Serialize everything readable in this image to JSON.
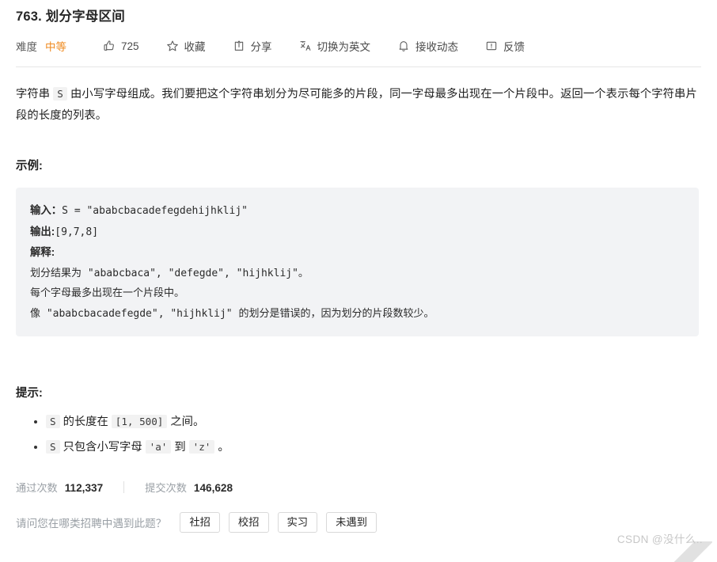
{
  "problem": {
    "title": "763. 划分字母区间",
    "description_parts": [
      {
        "type": "text",
        "value": "字符串 "
      },
      {
        "type": "code",
        "value": "S"
      },
      {
        "type": "text",
        "value": " 由小写字母组成。我们要把这个字符串划分为尽可能多的片段，同一字母最多出现在一个片段中。返回一个表示每个字符串片段的长度的列表。"
      }
    ],
    "description_plain": "字符串 S 由小写字母组成。我们要把这个字符串划分为尽可能多的片段，同一字母最多出现在一个片段中。返回一个表示每个字符串片段的长度的列表。"
  },
  "meta": {
    "difficulty_label": "难度",
    "difficulty_value": "中等",
    "difficulty_color": "#ef8b21",
    "likes": "725",
    "like_icon": "thumbs-up-icon",
    "favorite_label": "收藏",
    "favorite_icon": "star-icon",
    "share_label": "分享",
    "share_icon": "share-icon",
    "translate_label": "切换为英文",
    "translate_icon": "translate-icon",
    "subscribe_label": "接收动态",
    "subscribe_icon": "bell-icon",
    "feedback_label": "反馈",
    "feedback_icon": "feedback-icon"
  },
  "example": {
    "heading": "示例:",
    "input_label": "输入：",
    "input_value": "S = \"ababcbacadefegdehijhklij\"",
    "output_label": "输出:",
    "output_value": "[9,7,8]",
    "explain_label": "解释:",
    "explain_line1": "划分结果为 \"ababcbaca\", \"defegde\", \"hijhklij\"。",
    "explain_line2": "每个字母最多出现在一个片段中。",
    "explain_line3": "像 \"ababcbacadefegde\", \"hijhklij\" 的划分是错误的，因为划分的片段数较少。"
  },
  "hints": {
    "heading": "提示:",
    "items": [
      {
        "parts": [
          {
            "type": "code",
            "value": "S"
          },
          {
            "type": "text",
            "value": " 的长度在 "
          },
          {
            "type": "code",
            "value": "[1, 500]"
          },
          {
            "type": "text",
            "value": " 之间。"
          }
        ],
        "plain": "S 的长度在 [1, 500] 之间。"
      },
      {
        "parts": [
          {
            "type": "code",
            "value": "S"
          },
          {
            "type": "text",
            "value": " 只包含小写字母 "
          },
          {
            "type": "code",
            "value": "'a'"
          },
          {
            "type": "text",
            "value": " 到 "
          },
          {
            "type": "code",
            "value": "'z'"
          },
          {
            "type": "text",
            "value": " 。"
          }
        ],
        "plain": "S 只包含小写字母 'a' 到 'z' 。"
      }
    ]
  },
  "stats": {
    "pass_label": "通过次数",
    "pass_value": "112,337",
    "submit_label": "提交次数",
    "submit_value": "146,628"
  },
  "poll": {
    "question": "请问您在哪类招聘中遇到此题？",
    "options": [
      "社招",
      "校招",
      "实习",
      "未遇到"
    ]
  },
  "watermark": {
    "text": "CSDN @没什么.."
  }
}
